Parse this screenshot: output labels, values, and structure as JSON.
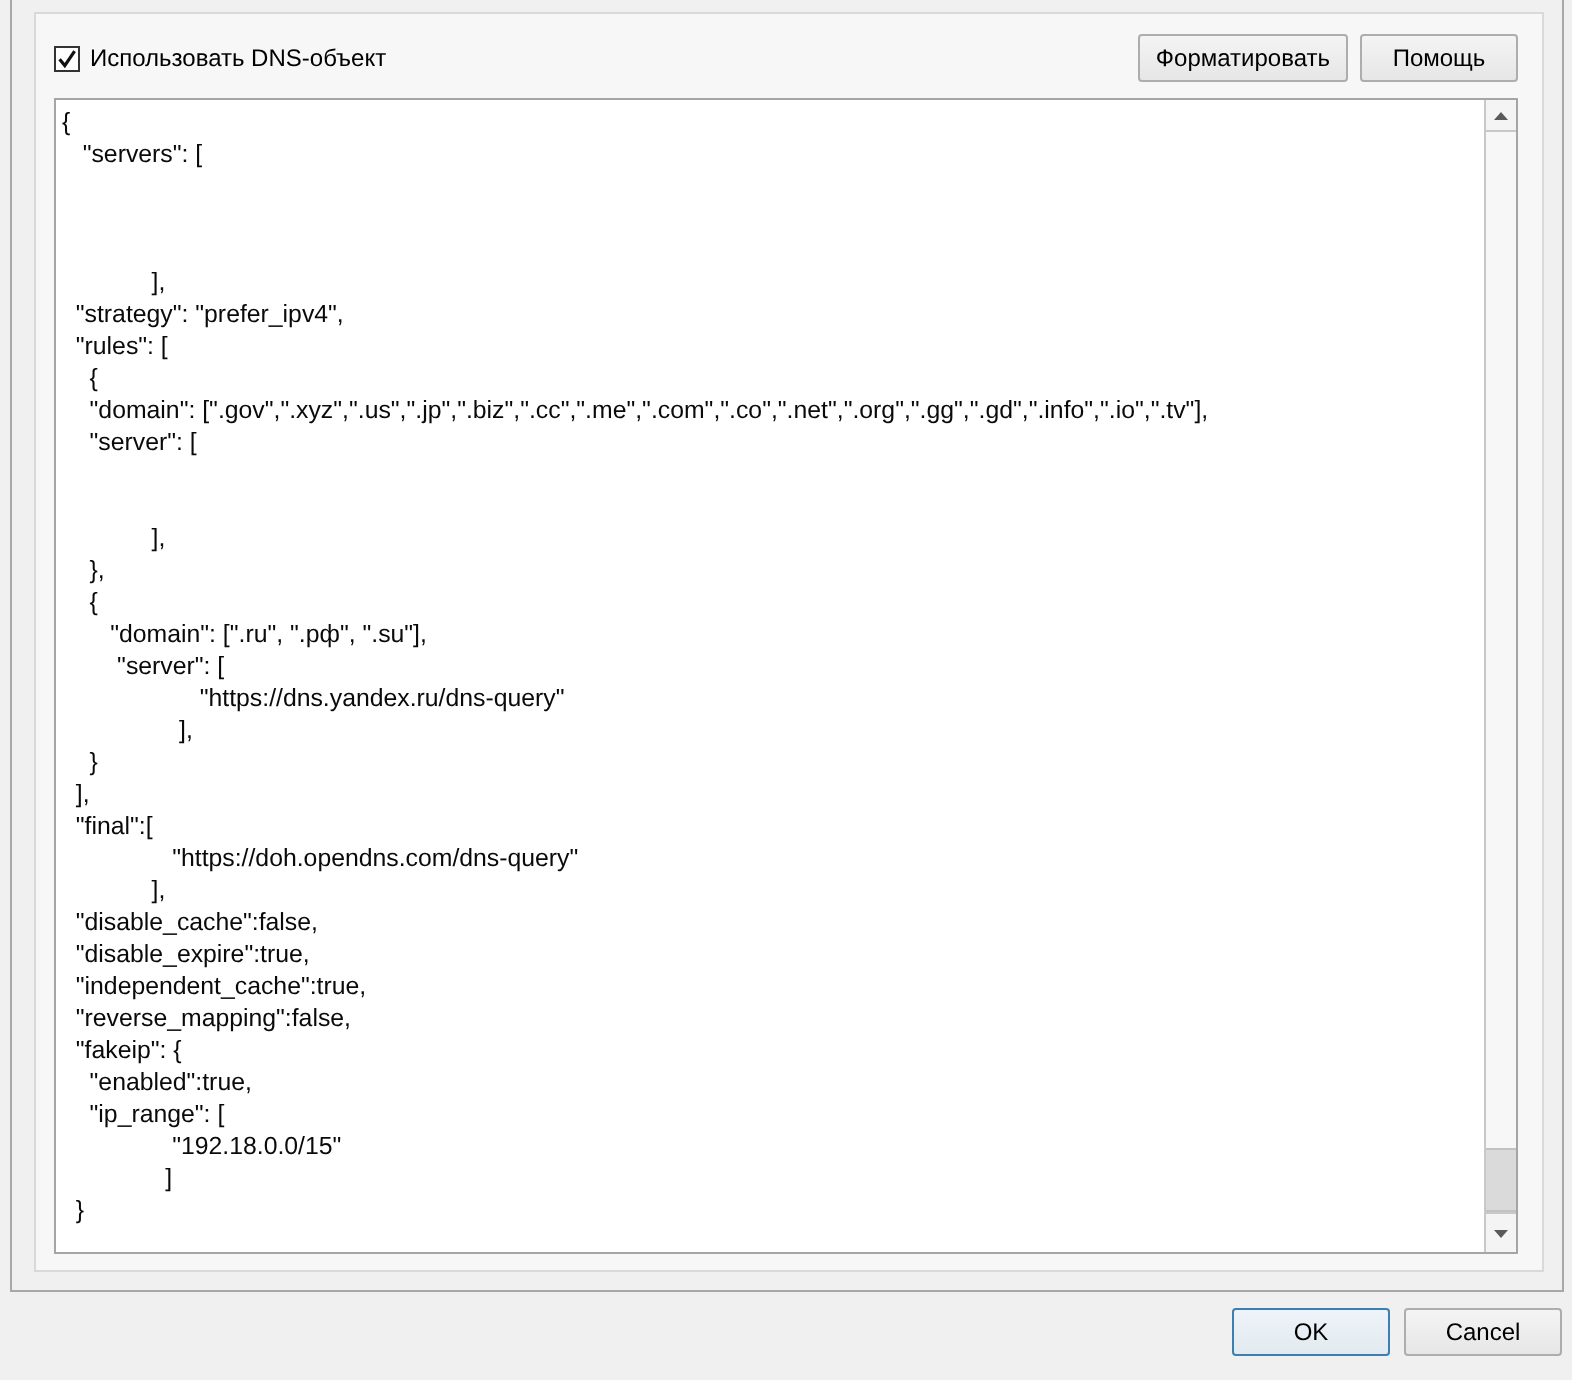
{
  "checkbox": {
    "label": "Использовать DNS-объект",
    "checked": true
  },
  "toolbar_buttons": [
    "Форматировать",
    "Помощь"
  ],
  "editor": {
    "text": "{\n   \"servers\": [\n\n\n\n             ],\n  \"strategy\": \"prefer_ipv4\",\n  \"rules\": [\n    {\n    \"domain\": [\".gov\",\".xyz\",\".us\",\".jp\",\".biz\",\".cc\",\".me\",\".com\",\".co\",\".net\",\".org\",\".gg\",\".gd\",\".info\",\".io\",\".tv\"],\n    \"server\": [\n\n\n             ],\n    },\n    {\n       \"domain\": [\".ru\", \".рф\", \".su\"],\n        \"server\": [\n                    \"https://dns.yandex.ru/dns-query\"\n                 ],\n    }\n  ],\n  \"final\":[\n                \"https://doh.opendns.com/dns-query\"\n             ],\n  \"disable_cache\":false,\n  \"disable_expire\":true,\n  \"independent_cache\":true,\n  \"reverse_mapping\":false,\n  \"fakeip\": {\n    \"enabled\":true,\n    \"ip_range\": [\n                \"192.18.0.0/15\"\n               ]\n  }"
  },
  "dialog_buttons": [
    {
      "label": "OK",
      "default": true
    },
    {
      "label": "Cancel",
      "default": false
    }
  ]
}
